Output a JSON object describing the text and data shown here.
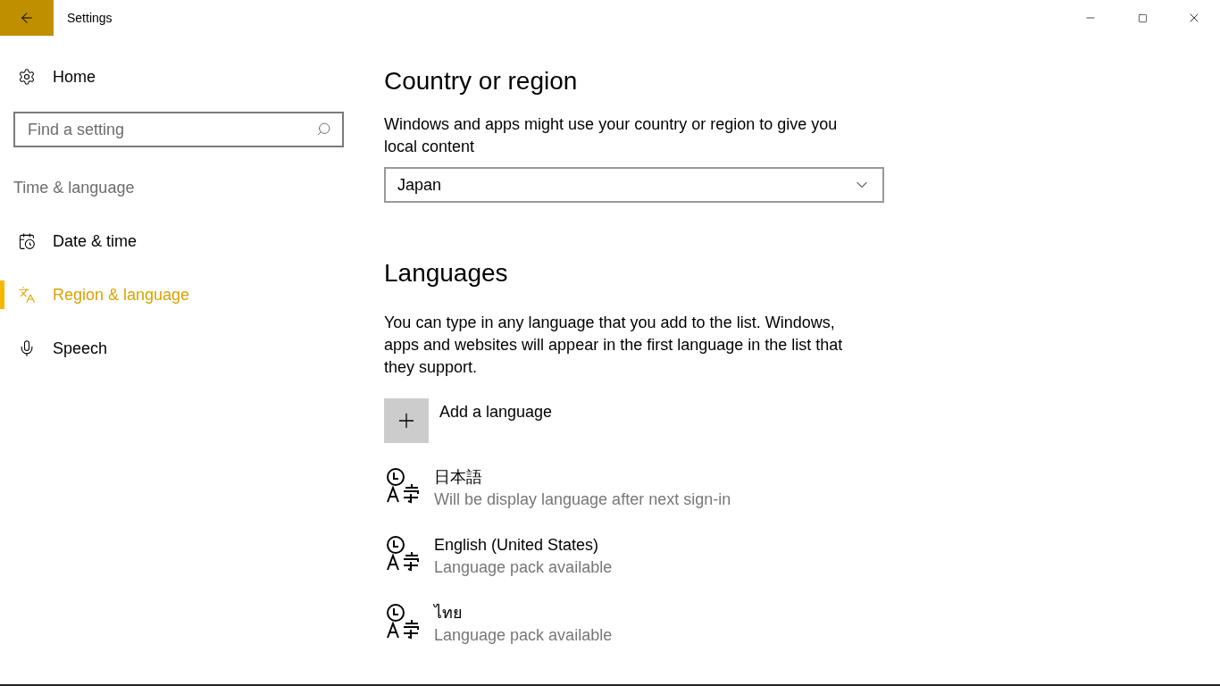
{
  "window": {
    "title": "Settings"
  },
  "sidebar": {
    "home": "Home",
    "search": {
      "placeholder": "Find a setting"
    },
    "section": "Time & language",
    "items": [
      {
        "label": "Date & time",
        "kind": "calendar",
        "selected": false
      },
      {
        "label": "Region & language",
        "kind": "region",
        "selected": true
      },
      {
        "label": "Speech",
        "kind": "mic",
        "selected": false
      }
    ]
  },
  "country": {
    "heading": "Country or region",
    "description": "Windows and apps might use your country or region to give you local content",
    "value": "Japan"
  },
  "languages": {
    "heading": "Languages",
    "description": "You can type in any language that you add to the list. Windows, apps and websites will appear in the first language in the list that they support.",
    "add": "Add a language",
    "items": [
      {
        "name": "日本語",
        "status": "Will be display language after next sign-in"
      },
      {
        "name": "English (United States)",
        "status": "Language pack available"
      },
      {
        "name": "ไทย",
        "status": "Language pack available"
      }
    ]
  }
}
